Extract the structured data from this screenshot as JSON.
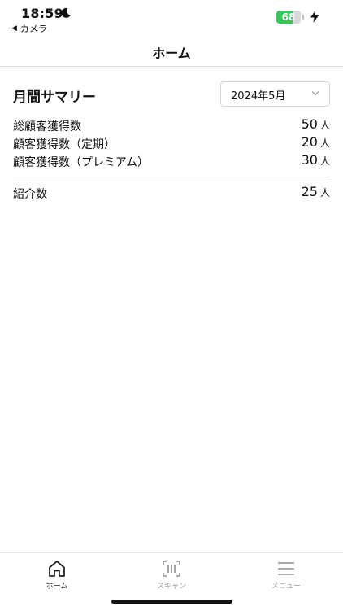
{
  "status_bar": {
    "time": "18:59",
    "back_label": "カメラ",
    "back_arrow": "◀",
    "battery_level": "68",
    "battery_fraction": 0.68,
    "battery_color": "#34c759"
  },
  "header": {
    "title": "ホーム"
  },
  "summary": {
    "title": "月間サマリー",
    "month_selected": "2024年5月",
    "stats": [
      {
        "label": "総顧客獲得数",
        "value": "50",
        "unit": "人"
      },
      {
        "label": "顧客獲得数（定期）",
        "value": "20",
        "unit": "人"
      },
      {
        "label": "顧客獲得数（プレミアム）",
        "value": "30",
        "unit": "人"
      }
    ],
    "referral": {
      "label": "紹介数",
      "value": "25",
      "unit": "人"
    }
  },
  "tabbar": {
    "items": [
      {
        "label": "ホーム",
        "icon": "home-icon",
        "active": true
      },
      {
        "label": "スキャン",
        "icon": "scan-icon",
        "active": false
      },
      {
        "label": "メニュー",
        "icon": "menu-icon",
        "active": false
      }
    ]
  }
}
